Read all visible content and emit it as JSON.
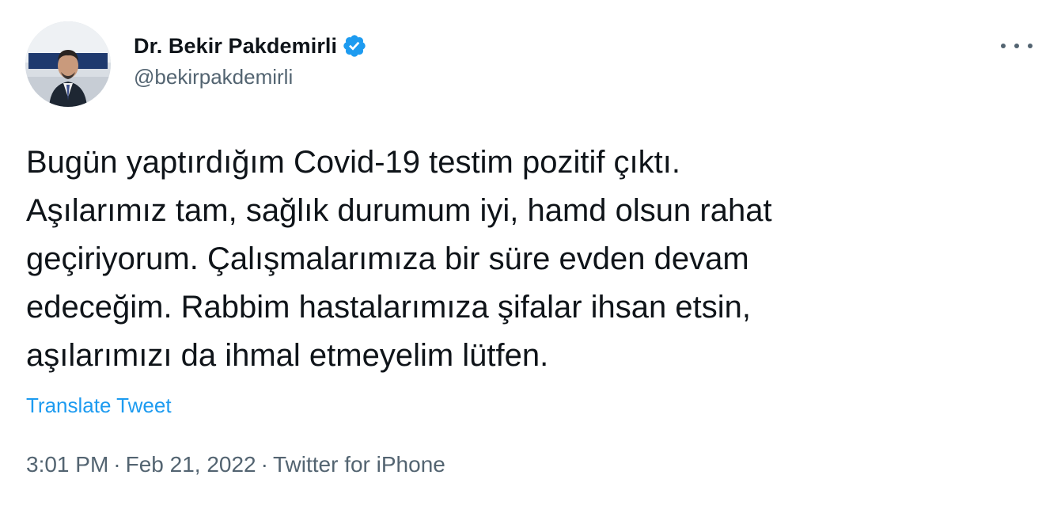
{
  "author": {
    "display_name": "Dr. Bekir Pakdemirli",
    "handle": "@bekirpakdemirli",
    "verified": true,
    "verified_color": "#1d9bf0"
  },
  "menu": {
    "icon": "more-horizontal-icon"
  },
  "tweet": {
    "text_lines": [
      "Bugün yaptırdığım Covid-19 testim pozitif çıktı.",
      "Aşılarımız tam, sağlık durumum iyi, hamd olsun rahat",
      "geçiriyorum. Çalışmalarımıza bir süre evden devam",
      "edeceğim. Rabbim hastalarımıza şifalar ihsan etsin,",
      "aşılarımızı da ihmal etmeyelim lütfen."
    ],
    "translate_label": "Translate Tweet"
  },
  "meta": {
    "time": "3:01 PM",
    "separator": "·",
    "date": "Feb 21, 2022",
    "source": "Twitter for iPhone"
  },
  "colors": {
    "text_primary": "#0f1419",
    "text_secondary": "#536471",
    "accent": "#1d9bf0"
  }
}
